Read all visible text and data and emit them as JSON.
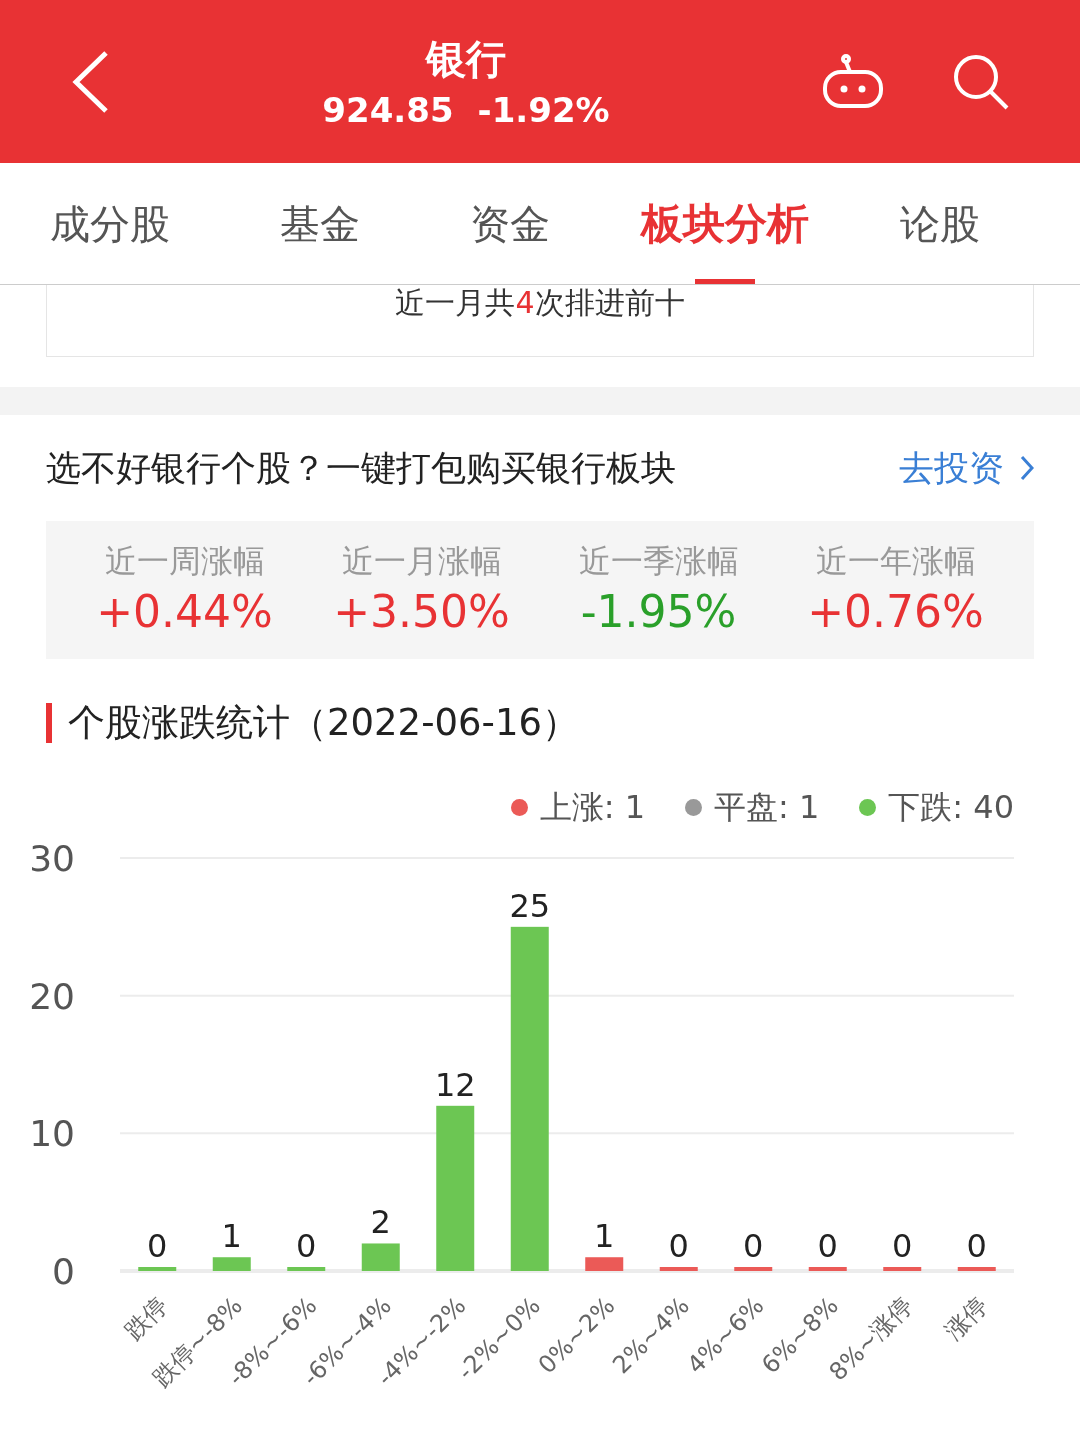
{
  "header": {
    "title": "银行",
    "price": "924.85",
    "change": "-1.92%"
  },
  "tabs": [
    {
      "label": "成分股",
      "selected": false
    },
    {
      "label": "基金",
      "selected": false
    },
    {
      "label": "资金",
      "selected": false
    },
    {
      "label": "板块分析",
      "selected": true
    },
    {
      "label": "论股",
      "selected": false
    }
  ],
  "rank_note": {
    "before": "近一月共",
    "count": "4",
    "after": "次排进前十"
  },
  "promo": {
    "title": "选不好银行个股？一键打包购买银行板块",
    "link": "去投资"
  },
  "stats": [
    {
      "label": "近一周涨幅",
      "value": "+0.44%",
      "color": "#e83234"
    },
    {
      "label": "近一月涨幅",
      "value": "+3.50%",
      "color": "#e83234"
    },
    {
      "label": "近一季涨幅",
      "value": "-1.95%",
      "color": "#2aa02a"
    },
    {
      "label": "近一年涨幅",
      "value": "+0.76%",
      "color": "#e83234"
    }
  ],
  "distribution": {
    "title": "个股涨跌统计（2022-06-16）",
    "legend": [
      {
        "label": "上涨: 1",
        "color": "#eb5a57"
      },
      {
        "label": "平盘: 1",
        "color": "#999999"
      },
      {
        "label": "下跌: 40",
        "color": "#6cc653"
      }
    ],
    "chart_data": {
      "type": "bar",
      "categories": [
        "跌停",
        "跌停~-8%",
        "-8%~-6%",
        "-6%~-4%",
        "-4%~-2%",
        "-2%~0%",
        "0%~2%",
        "2%~4%",
        "4%~6%",
        "6%~8%",
        "8%~涨停",
        "涨停"
      ],
      "series": [
        {
          "color": "#6cc653",
          "values": [
            0,
            1,
            0,
            2,
            12,
            25,
            null,
            null,
            null,
            null,
            null,
            null
          ]
        },
        {
          "color": "#eb5a57",
          "values": [
            null,
            null,
            null,
            null,
            null,
            null,
            1,
            0,
            0,
            0,
            0,
            0
          ]
        }
      ],
      "ylim": [
        0,
        30
      ],
      "yticks": [
        0,
        10,
        20,
        30
      ],
      "data_labels": true
    }
  }
}
